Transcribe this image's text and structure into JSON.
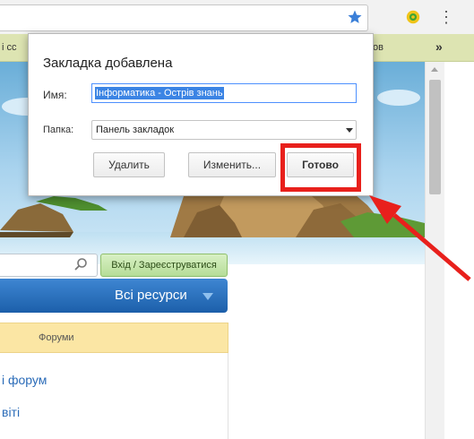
{
  "browser": {
    "bookmarks_bar": {
      "left_fragment": "i cc",
      "right_fragment": "ов",
      "more_label": "»"
    },
    "menu_icon_label": "⋮"
  },
  "dialog": {
    "title": "Закладка добавлена",
    "name_label": "Имя:",
    "name_value": "Інформатика - Острів знань",
    "folder_label": "Папка:",
    "folder_value": "Панель закладок",
    "remove_label": "Удалить",
    "edit_label": "Изменить...",
    "done_label": "Готово"
  },
  "page": {
    "login_label": "Вхід / Зареєструватися",
    "resources_label": "Всі ресурси",
    "forum_tab_label": "Форуми",
    "links": [
      "і форум",
      "віті"
    ]
  },
  "colors": {
    "highlight": "#e8201c",
    "star": "#3b7fd8",
    "resources_bar": "#1c5faa",
    "bookmarks_bar": "#dde4b2"
  },
  "icons": {
    "star": "bookmark-star-icon",
    "extension": "extension-icon",
    "search": "search-icon",
    "caret": "chevron-down-icon",
    "arrow": "red-arrow-annotation"
  }
}
